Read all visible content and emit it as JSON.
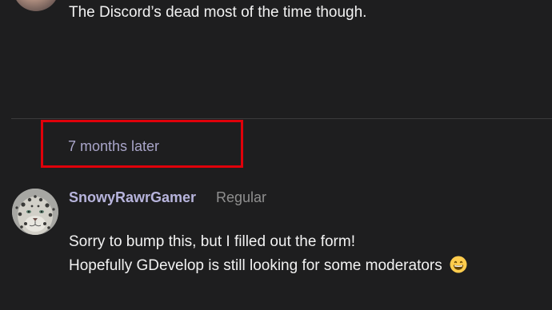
{
  "previous_post": {
    "text": "The Discord’s dead most of the time though."
  },
  "time_gap": {
    "label": "7 months later"
  },
  "post": {
    "username": "SnowyRawrGamer",
    "user_title": "Regular",
    "lines": [
      "Sorry to bump this, but I filled out the form!",
      "Hopefully GDevelop is still looking for some moderators"
    ],
    "emoji": "grinning-face-with-smiling-eyes-emoji"
  },
  "colors": {
    "background": "#1e1e1f",
    "body_text": "#f2f2f2",
    "username": "#b7b4dc",
    "user_title": "#8f8f8f",
    "time_gap_text": "#a9a5c9",
    "highlight_border": "#e0000a",
    "divider": "#3b3b3c"
  }
}
